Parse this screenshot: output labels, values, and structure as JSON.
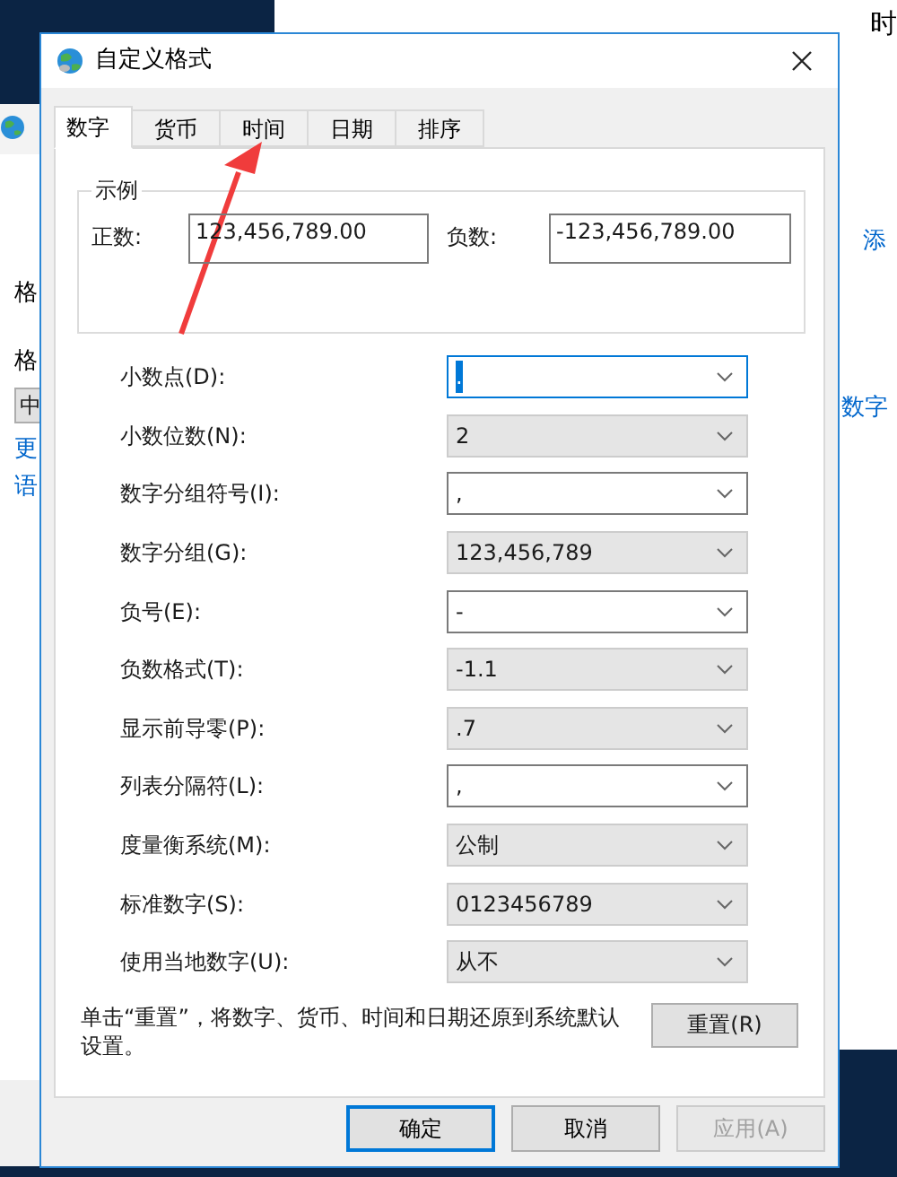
{
  "background_windows": {
    "right_window": {
      "heading": "时",
      "link": "添",
      "link_2": "数字"
    },
    "left_window": {
      "texts": [
        {
          "kind": "label",
          "text": "格"
        },
        {
          "kind": "label",
          "text": "格"
        },
        {
          "kind": "box",
          "text": "中"
        },
        {
          "kind": "link",
          "text": "更"
        },
        {
          "kind": "link",
          "text": "语"
        }
      ]
    }
  },
  "window": {
    "title": "自定义格式"
  },
  "tabs": [
    {
      "label": "数字",
      "selected": true
    },
    {
      "label": "货币",
      "selected": false
    },
    {
      "label": "时间",
      "selected": false
    },
    {
      "label": "日期",
      "selected": false
    },
    {
      "label": "排序",
      "selected": false
    }
  ],
  "example": {
    "title": "示例",
    "positive_label": "正数:",
    "positive_value": "123,456,789.00",
    "negative_label": "负数:",
    "negative_value": "-123,456,789.00"
  },
  "settings": [
    {
      "label": "小数点(D):",
      "value": ".",
      "kind": "editable",
      "focused": true
    },
    {
      "label": "小数位数(N):",
      "value": "2",
      "kind": "list",
      "focused": false
    },
    {
      "label": "数字分组符号(I):",
      "value": ",",
      "kind": "editable",
      "focused": false
    },
    {
      "label": "数字分组(G):",
      "value": "123,456,789",
      "kind": "list",
      "focused": false
    },
    {
      "label": "负号(E):",
      "value": "-",
      "kind": "editable",
      "focused": false
    },
    {
      "label": "负数格式(T):",
      "value": "-1.1",
      "kind": "list",
      "focused": false
    },
    {
      "label": "显示前导零(P):",
      "value": ".7",
      "kind": "list",
      "focused": false
    },
    {
      "label": "列表分隔符(L):",
      "value": ",",
      "kind": "editable",
      "focused": false
    },
    {
      "label": "度量衡系统(M):",
      "value": "公制",
      "kind": "list",
      "focused": false
    },
    {
      "label": "标准数字(S):",
      "value": "0123456789",
      "kind": "list",
      "focused": false
    },
    {
      "label": "使用当地数字(U):",
      "value": "从不",
      "kind": "list",
      "focused": false
    }
  ],
  "reset_note": "单击“重置”，将数字、货币、时间和日期还原到系统默认设置。",
  "reset_button": "重置(R)",
  "buttons": [
    {
      "label": "确定",
      "default": true,
      "disabled": false
    },
    {
      "label": "取消",
      "default": false,
      "disabled": false
    },
    {
      "label": "应用(A)",
      "default": false,
      "disabled": true
    }
  ]
}
